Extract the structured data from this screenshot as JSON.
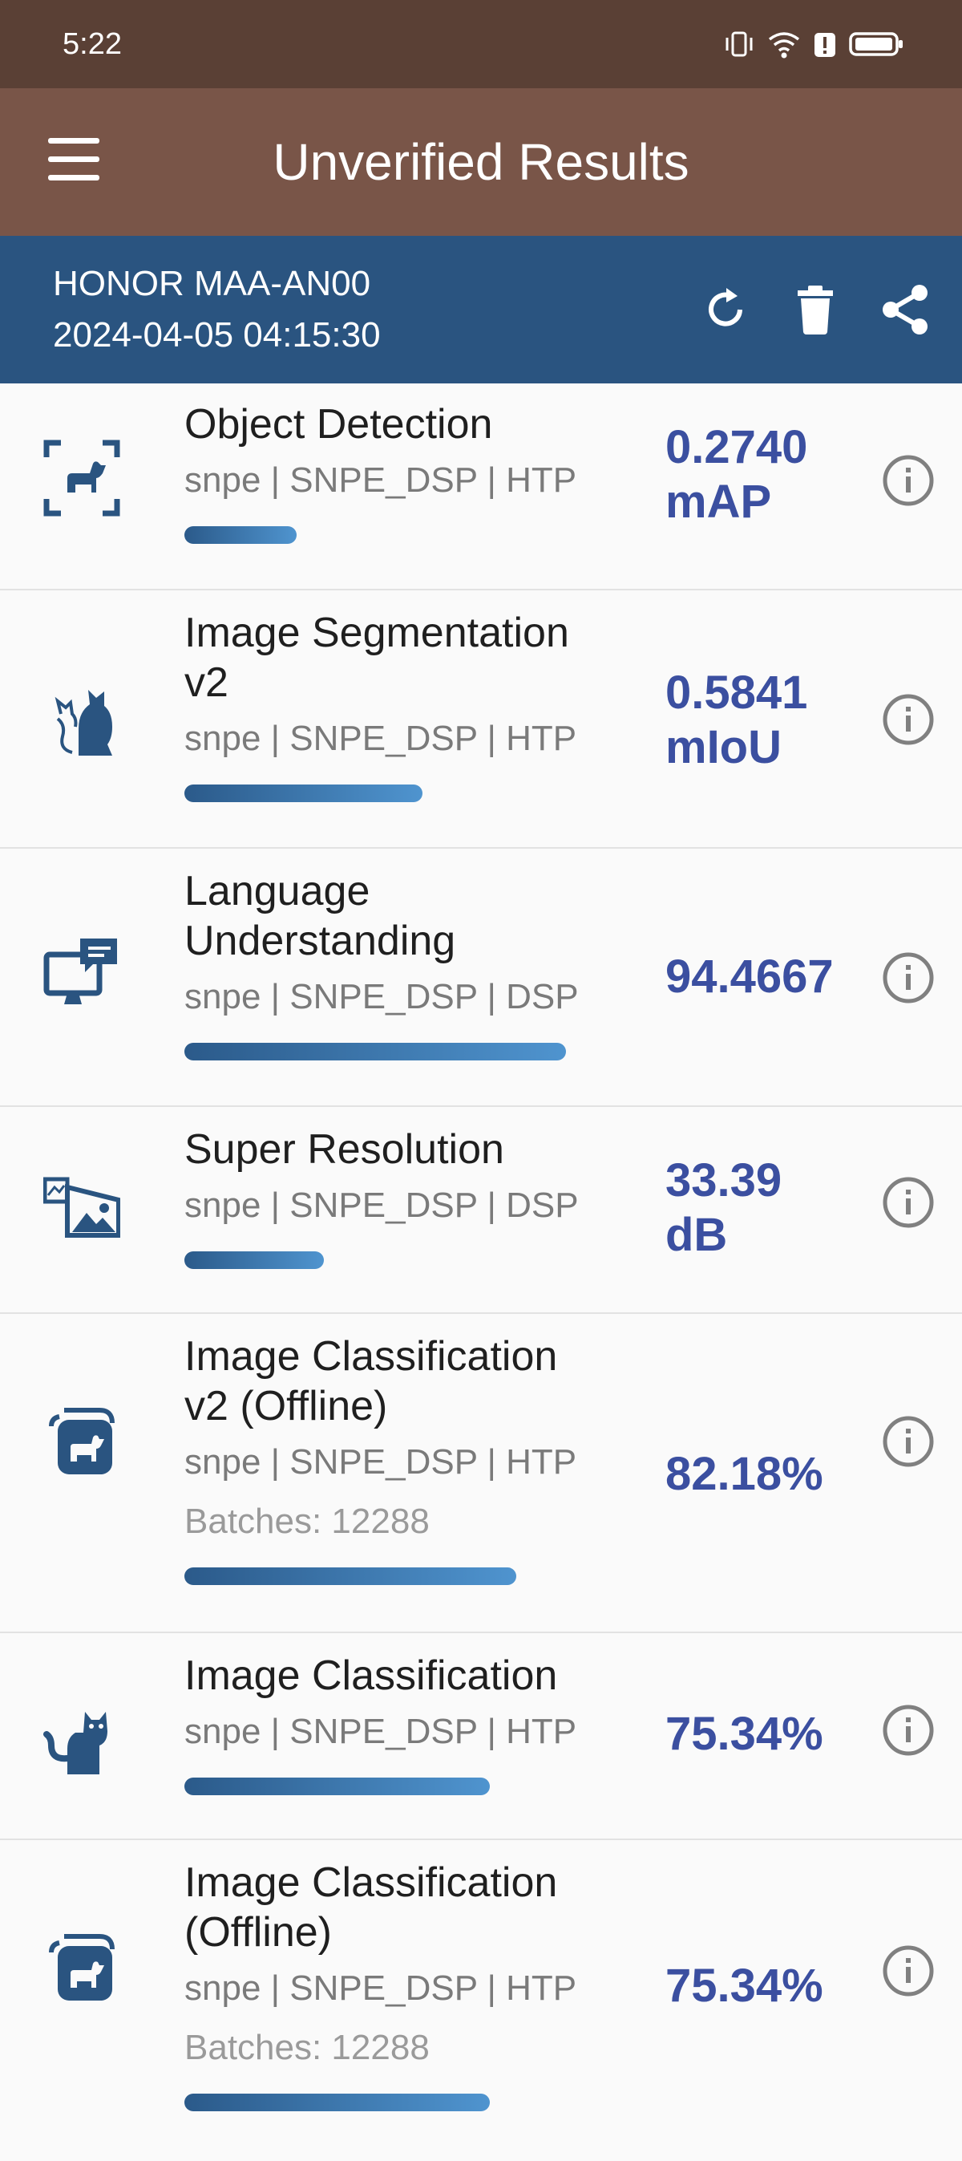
{
  "status_bar": {
    "time": "5:22"
  },
  "app_bar": {
    "title": "Unverified Results"
  },
  "device": {
    "name": "HONOR MAA-AN00",
    "datetime": "2024-04-05 04:15:30"
  },
  "results": [
    {
      "name": "Object Detection",
      "sub": "snpe | SNPE_DSP | HTP",
      "score_line1": "0.2740",
      "score_line2": "mAP",
      "batches": "",
      "progress": 0.25
    },
    {
      "name_line1": "Image Segmentation",
      "name_line2": "v2",
      "sub": "snpe | SNPE_DSP | HTP",
      "score_line1": "0.5841",
      "score_line2": "mIoU",
      "batches": "",
      "progress": 0.53
    },
    {
      "name_line1": "Language",
      "name_line2": "Understanding",
      "sub": "snpe | SNPE_DSP | DSP",
      "score": "94.4667",
      "batches": "",
      "progress": 0.85
    },
    {
      "name": "Super Resolution",
      "sub": "snpe | SNPE_DSP | DSP",
      "score_line1": "33.39",
      "score_line2": "dB",
      "batches": "",
      "progress": 0.31
    },
    {
      "name_line1": "Image Classification",
      "name_line2": "v2 (Offline)",
      "sub": "snpe | SNPE_DSP | HTP",
      "score": "82.18%",
      "batches": "Batches: 12288",
      "progress": 0.74
    },
    {
      "name": "Image Classification",
      "sub": "snpe | SNPE_DSP | HTP",
      "score": "75.34%",
      "batches": "",
      "progress": 0.68
    },
    {
      "name_line1": "Image Classification",
      "name_line2": "(Offline)",
      "sub": "snpe | SNPE_DSP | HTP",
      "score": "75.34%",
      "batches": "Batches: 12288",
      "progress": 0.68
    }
  ]
}
